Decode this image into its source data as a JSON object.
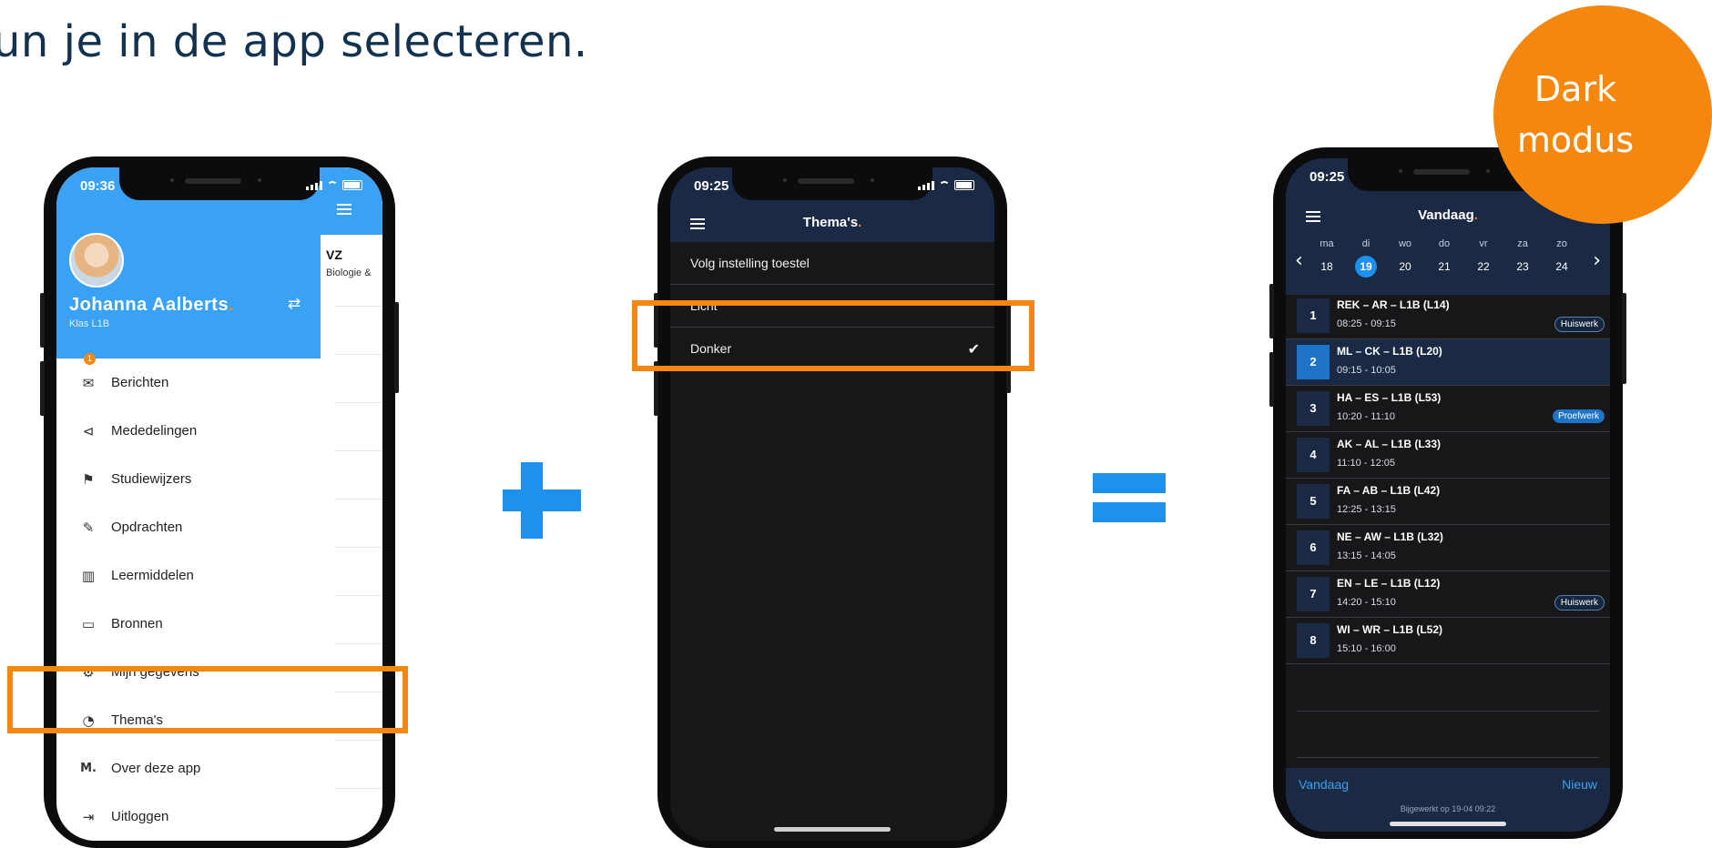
{
  "headline": "un je in de app selecteren.",
  "badge": {
    "line1": "Dark",
    "line2": "modus"
  },
  "phone1": {
    "time": "09:36",
    "user_name": "Johanna  Aalberts",
    "name_dot": ".",
    "class": "Klas L1B",
    "swap_icon": "⇄",
    "peek_title": "VZ",
    "peek_sub": "Biologie &",
    "notification_count": "1",
    "menu": [
      {
        "label": "Berichten",
        "icon": "mail-icon",
        "glyph": "✉"
      },
      {
        "label": "Mededelingen",
        "icon": "megaphone-icon",
        "glyph": "📢"
      },
      {
        "label": "Studiewijzers",
        "icon": "signpost-icon",
        "glyph": "⚑"
      },
      {
        "label": "Opdrachten",
        "icon": "pencil-icon",
        "glyph": "✎"
      },
      {
        "label": "Leermiddelen",
        "icon": "books-icon",
        "glyph": "▥"
      },
      {
        "label": "Bronnen",
        "icon": "folder-icon",
        "glyph": "▭"
      },
      {
        "label": "Mijn gegevens",
        "icon": "gear-icon",
        "glyph": "⚙"
      },
      {
        "label": "Thema's",
        "icon": "palette-icon",
        "glyph": "◔"
      },
      {
        "label": "Over deze app",
        "icon": "magister-logo-icon",
        "glyph": "M."
      },
      {
        "label": "Uitloggen",
        "icon": "logout-icon",
        "glyph": "⇥"
      }
    ]
  },
  "phone2": {
    "time": "09:25",
    "title": "Thema's",
    "title_dot": ".",
    "options": [
      {
        "label": "Volg instelling toestel",
        "checked": false
      },
      {
        "label": "Licht",
        "checked": false
      },
      {
        "label": "Donker",
        "checked": true
      }
    ],
    "check_glyph": "✔"
  },
  "phone3": {
    "time": "09:25",
    "title": "Vandaag",
    "title_dot": ".",
    "prev_glyph": "‹",
    "next_glyph": "›",
    "days": [
      {
        "name": "ma",
        "date": "18",
        "selected": false
      },
      {
        "name": "di",
        "date": "19",
        "selected": true
      },
      {
        "name": "wo",
        "date": "20",
        "selected": false
      },
      {
        "name": "do",
        "date": "21",
        "selected": false
      },
      {
        "name": "vr",
        "date": "22",
        "selected": false
      },
      {
        "name": "za",
        "date": "23",
        "selected": false
      },
      {
        "name": "zo",
        "date": "24",
        "selected": false
      }
    ],
    "lessons": [
      {
        "num": "1",
        "title": "REK – AR – L1B (L14)",
        "time": "08:25 - 09:15",
        "tag": "Huiswerk",
        "tag_type": "hw",
        "active": false
      },
      {
        "num": "2",
        "title": "ML – CK – L1B (L20)",
        "time": "09:15 - 10:05",
        "tag": "",
        "tag_type": "",
        "active": true
      },
      {
        "num": "3",
        "title": "HA – ES – L1B (L53)",
        "time": "10:20 - 11:10",
        "tag": "Proefwerk",
        "tag_type": "pw",
        "active": false
      },
      {
        "num": "4",
        "title": "AK – AL – L1B (L33)",
        "time": "11:10 - 12:05",
        "tag": "",
        "tag_type": "",
        "active": false
      },
      {
        "num": "5",
        "title": "FA – AB – L1B (L42)",
        "time": "12:25 - 13:15",
        "tag": "",
        "tag_type": "",
        "active": false
      },
      {
        "num": "6",
        "title": "NE – AW – L1B (L32)",
        "time": "13:15 - 14:05",
        "tag": "",
        "tag_type": "",
        "active": false
      },
      {
        "num": "7",
        "title": "EN – LE – L1B (L12)",
        "time": "14:20 - 15:10",
        "tag": "Huiswerk",
        "tag_type": "hw",
        "active": false
      },
      {
        "num": "8",
        "title": "WI – WR – L1B (L52)",
        "time": "15:10 - 16:00",
        "tag": "",
        "tag_type": "",
        "active": false
      }
    ],
    "footer_left": "Vandaag",
    "footer_right": "Nieuw",
    "updated": "Bijgewerkt op 19-04 09:22"
  },
  "colors": {
    "accent_orange": "#f5870f",
    "brand_blue": "#3aa2f4",
    "operator_blue": "#1e90ee",
    "dark_header": "#1a2a44",
    "dark_bg": "#17171a"
  }
}
